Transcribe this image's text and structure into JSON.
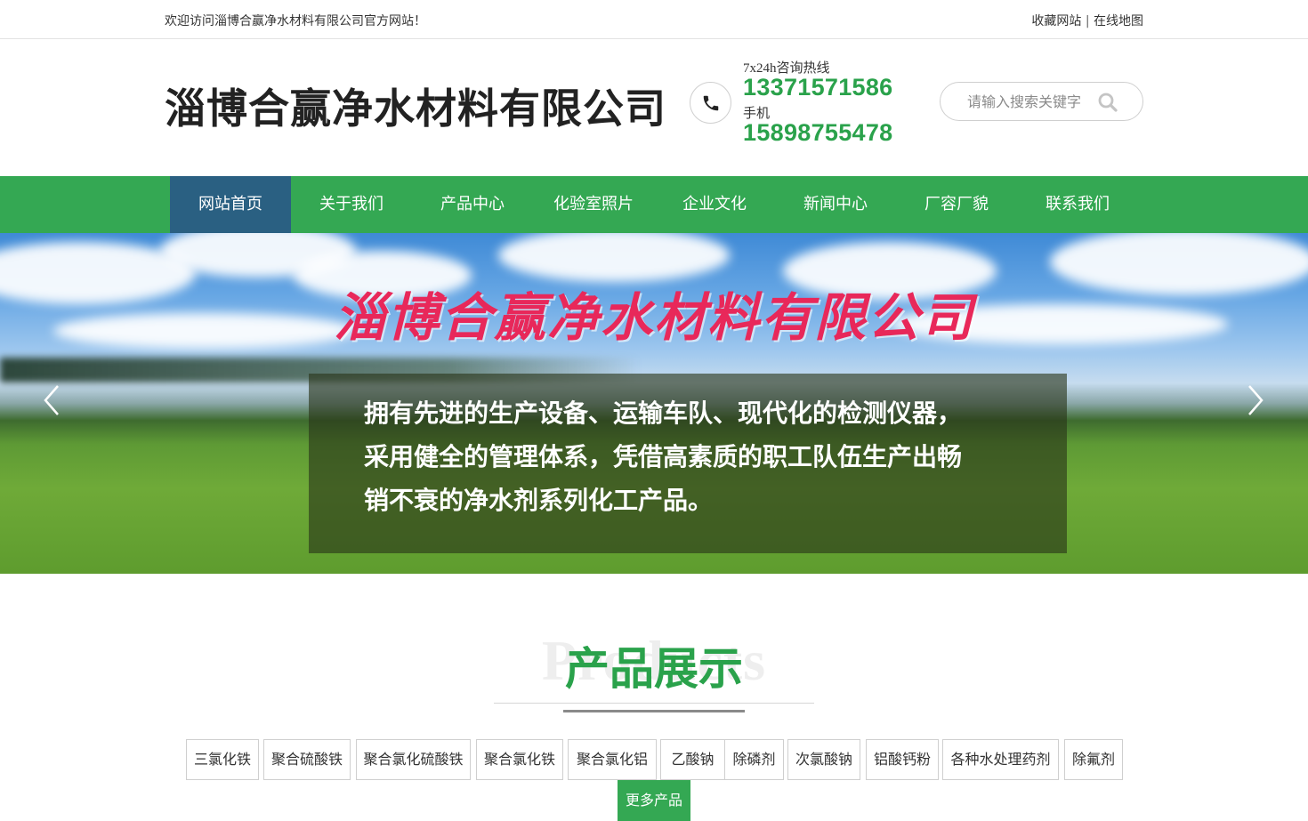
{
  "topbar": {
    "welcome": "欢迎访问淄博合赢净水材料有限公司官方网站！",
    "bookmark": "收藏网站",
    "separator": "|",
    "sitemap": "在线地图"
  },
  "header": {
    "company_name": "淄博合赢净水材料有限公司",
    "hotline_label": "7x24h咨询热线",
    "hotline_number": "13371571586",
    "mobile_label": "手机",
    "mobile_number": "15898755478",
    "search_placeholder": "请输入搜索关键字",
    "icons": {
      "phone": "phone-icon",
      "search": "search-icon"
    }
  },
  "nav": {
    "items": [
      "网站首页",
      "关于我们",
      "产品中心",
      "化验室照片",
      "企业文化",
      "新闻中心",
      "厂容厂貌",
      "联系我们"
    ],
    "active_index": 0
  },
  "banner": {
    "title": "淄博合赢净水材料有限公司",
    "caption_lines": [
      "拥有先进的生产设备、运输车队、现代化的检测仪器，",
      "采用健全的管理体系，凭借高素质的职工队伍生产出畅",
      "销不衰的净水剂系列化工产品。"
    ],
    "icons": {
      "prev": "chevron-left-icon",
      "next": "chevron-right-icon"
    }
  },
  "products": {
    "bg_word": "Products",
    "title": "产品展示",
    "categories": [
      "三氯化铁",
      "聚合硫酸铁",
      "聚合氯化硫酸铁",
      "聚合氯化铁",
      "聚合氯化铝",
      "乙酸钠",
      "除磷剂",
      "次氯酸钠",
      "铝酸钙粉",
      "各种水处理药剂",
      "除氟剂"
    ],
    "more_label": "更多产品"
  },
  "colors": {
    "brand_green": "#34a853",
    "number_green": "#2aa24b",
    "nav_active": "#2a6082",
    "banner_title": "#e8285a"
  }
}
